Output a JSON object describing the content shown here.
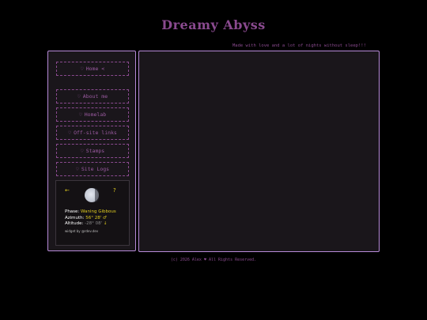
{
  "header": {
    "title": "Dreamy Abyss",
    "tagline": "Made with love and a lot of nights without sleep!!!"
  },
  "nav": {
    "items": [
      {
        "label": "Home <",
        "icon": "heart-icon",
        "current": true
      },
      {
        "label": "About me",
        "icon": "heart-icon"
      },
      {
        "label": "Homelab",
        "icon": "heart-icon"
      },
      {
        "label": "Off-site links",
        "icon": "heart-icon"
      },
      {
        "label": "Stamps",
        "icon": "heart-icon"
      },
      {
        "label": "Site Logs",
        "icon": "heart-icon"
      }
    ],
    "heart_glyph": "♡"
  },
  "moon_widget": {
    "prev_arrow": "←",
    "next_arrow": "?",
    "phase_label": "Phase:",
    "phase_value": "Waning Gibbous",
    "azimuth_label": "Azimuth:",
    "azimuth_value": "56° 28'",
    "azimuth_symbol": "♂",
    "altitude_label": "Altitude:",
    "altitude_value": "-28° 08'",
    "altitude_symbol": "↓",
    "credit": "widget by @rdev.dev"
  },
  "footer": {
    "text": "(c) 2026 Alex ♥ All Rights Reserved."
  },
  "colors": {
    "background": "#000000",
    "panel": "#1a161b",
    "border": "#b78ad8",
    "accent_purple": "#8a4a8f",
    "accent_yellow": "#e0cc20"
  }
}
